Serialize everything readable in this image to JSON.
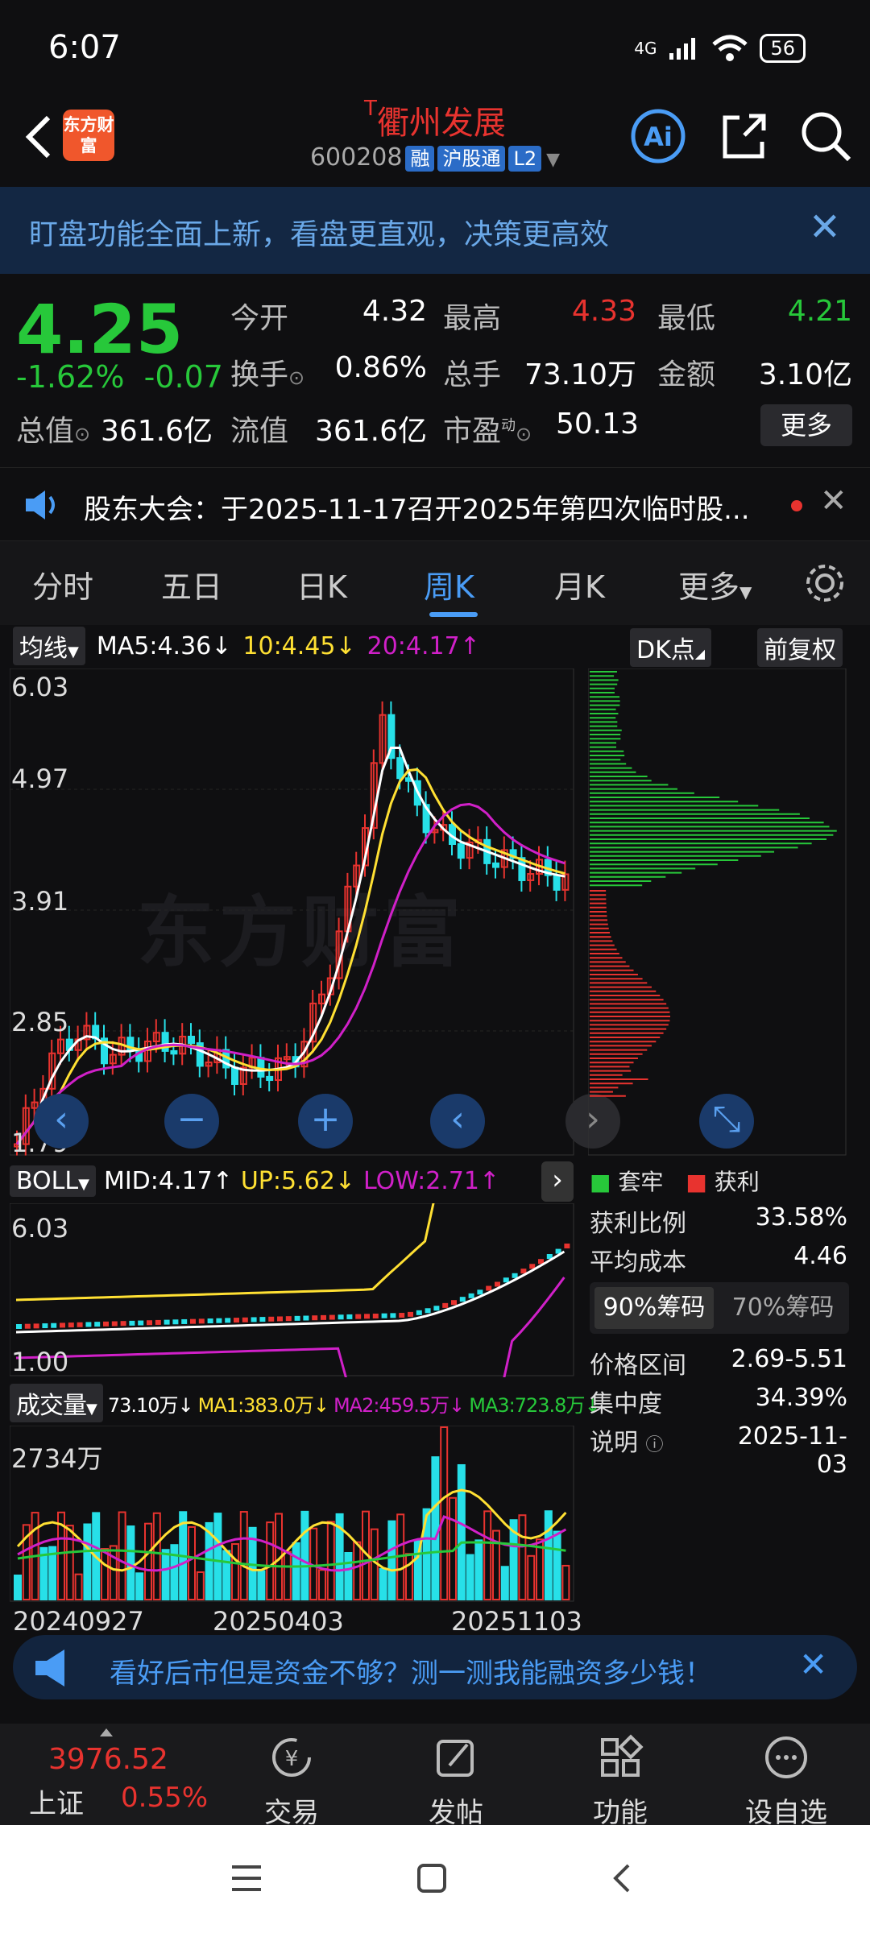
{
  "status": {
    "time": "6:07",
    "network": "4G",
    "battery": "56"
  },
  "header": {
    "logo": "东方财富",
    "t_mark": "T",
    "title": "衢州发展",
    "code": "600208",
    "tags": [
      "融",
      "沪股通",
      "L2"
    ]
  },
  "banner": {
    "text": "盯盘功能全面上新，看盘更直观，决策更高效"
  },
  "quote": {
    "price": "4.25",
    "change_pct": "-1.62%",
    "change": "-0.07",
    "open_label": "今开",
    "open": "4.32",
    "high_label": "最高",
    "high": "4.33",
    "low_label": "最低",
    "low": "4.21",
    "turnover_label": "换手",
    "turnover": "0.86%",
    "volume_label": "总手",
    "volume": "73.10万",
    "amount_label": "金额",
    "amount": "3.10亿",
    "mktcap_label": "总值",
    "mktcap": "361.6亿",
    "float_label": "流值",
    "float": "361.6亿",
    "pe_label": "市盈",
    "pe_sup": "动",
    "pe": "50.13",
    "more": "更多"
  },
  "notice": {
    "text": "股东大会：于2025-11-17召开2025年第四次临时股..."
  },
  "tabs": [
    "分时",
    "五日",
    "日K",
    "周K",
    "月K",
    "更多"
  ],
  "ma_bar": {
    "selector": "均线",
    "ma5": "MA5:4.36",
    "ma10": "10:4.45",
    "ma20": "20:4.17",
    "dk": "DK点",
    "adjust": "前复权"
  },
  "main_axis": [
    "6.03",
    "4.97",
    "3.91",
    "2.85",
    "1.79"
  ],
  "boll_bar": {
    "selector": "BOLL",
    "mid": "MID:4.17",
    "up": "UP:5.62",
    "low": "LOW:2.71"
  },
  "boll_axis": [
    "6.03",
    "1.00"
  ],
  "vol_bar": {
    "selector": "成交量",
    "vol": "73.10万",
    "ma1": "MA1:383.0万",
    "ma2": "MA2:459.5万",
    "ma3": "MA3:723.8万"
  },
  "vol_axis": {
    "max": "2734万"
  },
  "dates": [
    "20240927",
    "20250403",
    "20251103"
  ],
  "chips": {
    "legend_trapped": "套牢",
    "legend_profit": "获利",
    "rows": [
      {
        "label": "获利比例",
        "value": "33.58%"
      },
      {
        "label": "平均成本",
        "value": "4.46"
      }
    ],
    "tab90": "90%筹码",
    "tab70": "70%筹码",
    "rows2": [
      {
        "label": "价格区间",
        "value": "2.69-5.51"
      },
      {
        "label": "集中度",
        "value": "34.39%"
      },
      {
        "label": "说明",
        "value": "2025-11-03"
      }
    ]
  },
  "watermark": "东方财富",
  "promo": {
    "text": "看好后市但是资金不够？测一测我能融资多少钱！"
  },
  "bottom": {
    "index_value": "3976.52",
    "index_name": "上证",
    "index_change": "0.55%",
    "items": [
      "交易",
      "发帖",
      "功能",
      "设自选"
    ]
  },
  "colors": {
    "up": "#e8332f",
    "down": "#27c83a",
    "accent": "#4a9cf5",
    "ma10": "#ffe033",
    "ma20": "#d020c8"
  },
  "chart_data": {
    "type": "candlestick",
    "x": [
      "20240927",
      "20250403",
      "20251103"
    ],
    "close": [
      1.9,
      2.6,
      2.9,
      2.7,
      2.75,
      2.8,
      2.7,
      2.55,
      2.55,
      2.6,
      3.2,
      4.2,
      5.6,
      4.9,
      4.6,
      4.5,
      4.4,
      4.3,
      4.25
    ],
    "ylim": [
      1.79,
      6.03
    ]
  }
}
